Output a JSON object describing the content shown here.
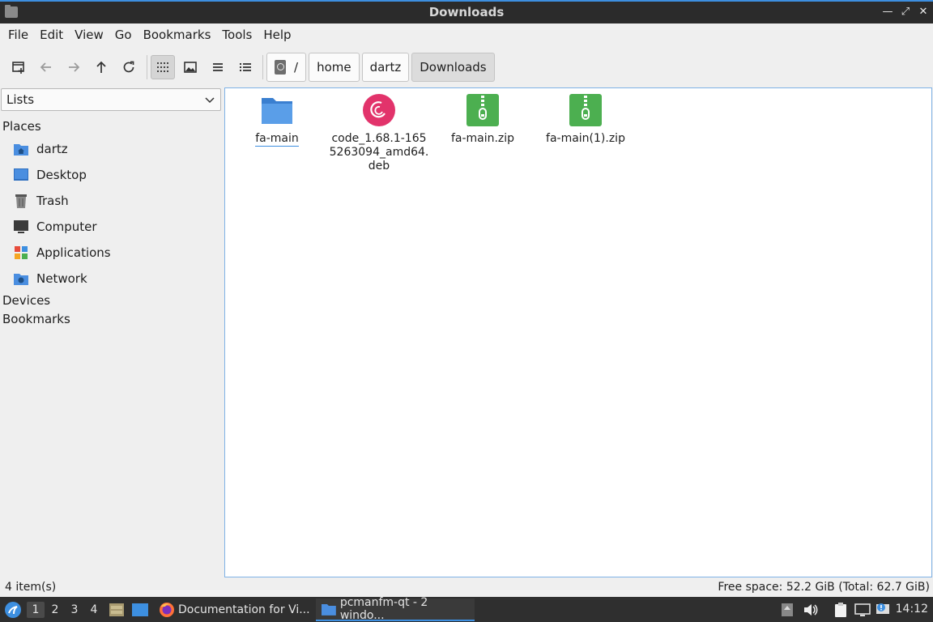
{
  "window": {
    "title": "Downloads"
  },
  "menu": [
    "File",
    "Edit",
    "View",
    "Go",
    "Bookmarks",
    "Tools",
    "Help"
  ],
  "toolbar": {
    "buttons": [
      "new-tab-icon",
      "back-arrow-icon",
      "forward-arrow-icon",
      "up-arrow-icon",
      "reload-icon",
      "icon-view-icon",
      "thumbnail-view-icon",
      "compact-view-icon",
      "detailed-list-icon"
    ],
    "active_view": "icon-view-icon"
  },
  "path": {
    "segments": [
      "/",
      "home",
      "dartz",
      "Downloads"
    ],
    "current": "Downloads"
  },
  "sidepane": {
    "mode": "Lists",
    "places_header": "Places",
    "places": [
      {
        "label": "dartz",
        "icon": "home-folder-icon"
      },
      {
        "label": "Desktop",
        "icon": "desktop-icon"
      },
      {
        "label": "Trash",
        "icon": "trash-icon"
      },
      {
        "label": "Computer",
        "icon": "computer-icon"
      },
      {
        "label": "Applications",
        "icon": "applications-icon"
      },
      {
        "label": "Network",
        "icon": "network-icon"
      }
    ],
    "devices_header": "Devices",
    "bookmarks_header": "Bookmarks"
  },
  "files": [
    {
      "name": "fa-main",
      "icon": "folder-icon"
    },
    {
      "name_lines": [
        "code_1.68.1-165",
        "5263094_amd64.",
        "deb"
      ],
      "icon": "debian-package-icon"
    },
    {
      "name": "fa-main.zip",
      "icon": "zip-archive-icon"
    },
    {
      "name": "fa-main(1).zip",
      "icon": "zip-archive-icon"
    }
  ],
  "status": {
    "count": "4 item(s)",
    "free_space": "Free space: 52.2 GiB (Total: 62.7 GiB)"
  },
  "taskbar": {
    "workspaces": [
      "1",
      "2",
      "3",
      "4"
    ],
    "current_workspace": "1",
    "tasks": [
      {
        "label": "Documentation for Vi...",
        "icon": "firefox-icon"
      },
      {
        "label": "pcmanfm-qt - 2 windo...",
        "icon": "folder-icon"
      }
    ],
    "clock": "14:12"
  },
  "colors": {
    "accent": "#3d8fe0",
    "folder": "#4a8ee0",
    "zip": "#4caf50",
    "debian": "#d70a53"
  }
}
